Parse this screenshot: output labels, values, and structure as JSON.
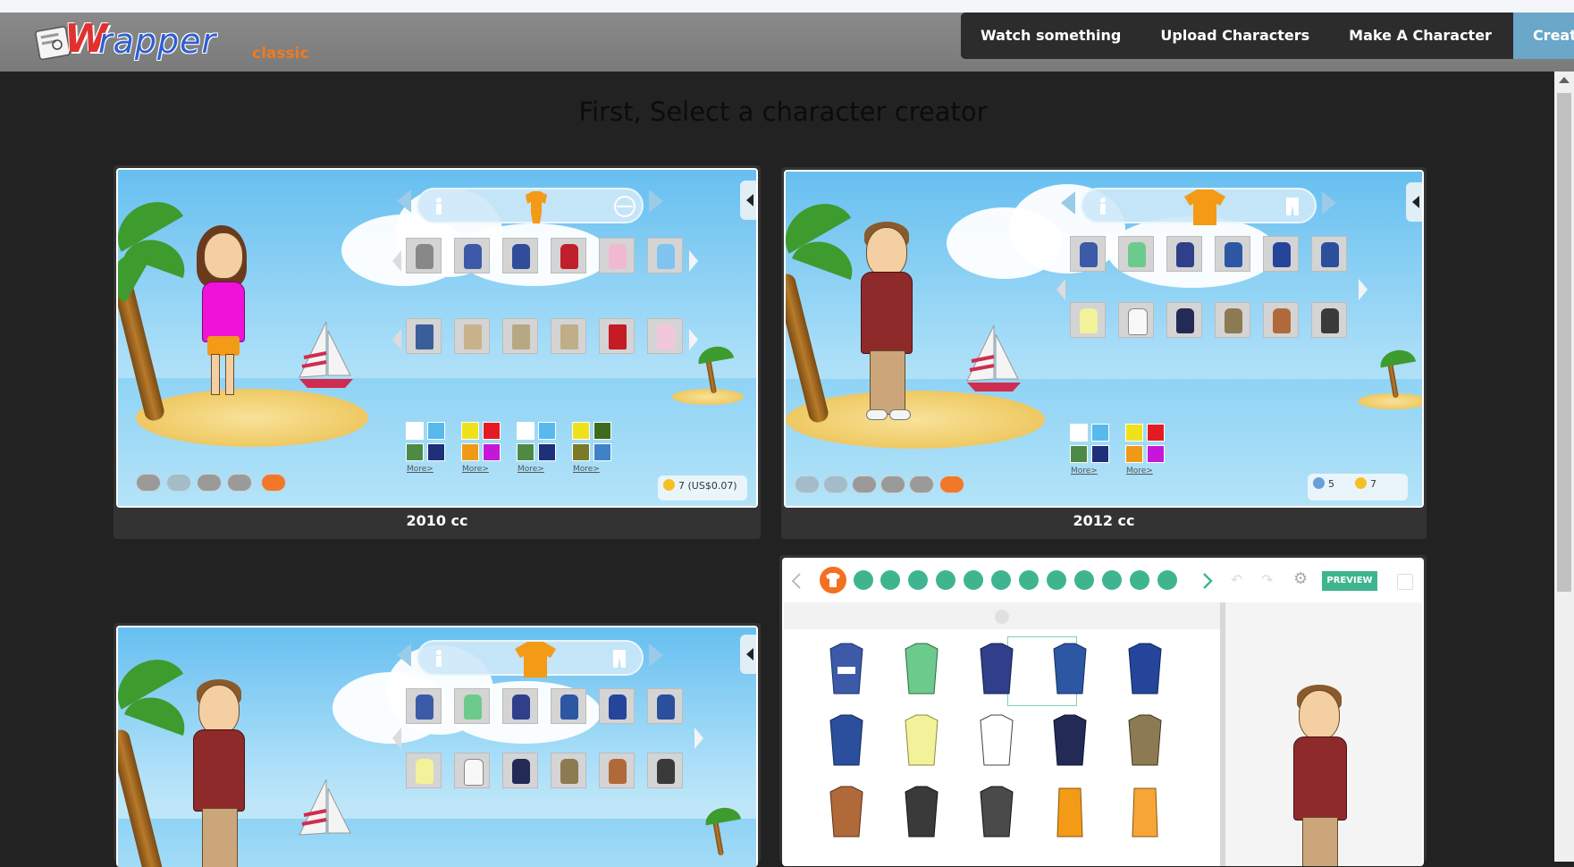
{
  "header": {
    "logo_main": "rapper",
    "logo_w": "W",
    "logo_suffix": "classic",
    "nav": [
      {
        "label": "Watch something"
      },
      {
        "label": "Upload Characters"
      },
      {
        "label": "Make A Character"
      },
      {
        "label": "Create"
      }
    ]
  },
  "page": {
    "heading": "First, Select a character creator"
  },
  "cards": [
    {
      "label": "2010 cc",
      "price": "7 (US$0.07)",
      "more": "More>"
    },
    {
      "label": "2012 cc",
      "bucks": "5",
      "coins": "7",
      "more": "More>"
    }
  ],
  "card4": {
    "preview": "PREVIEW"
  },
  "colors": {
    "background": "#222222",
    "header": "#808080",
    "nav_bg": "#2c2c2c",
    "create_bg": "#6aa7c9",
    "card_bg": "#333333",
    "accent_orange": "#f39a17",
    "preview_green": "#3fb58f"
  }
}
